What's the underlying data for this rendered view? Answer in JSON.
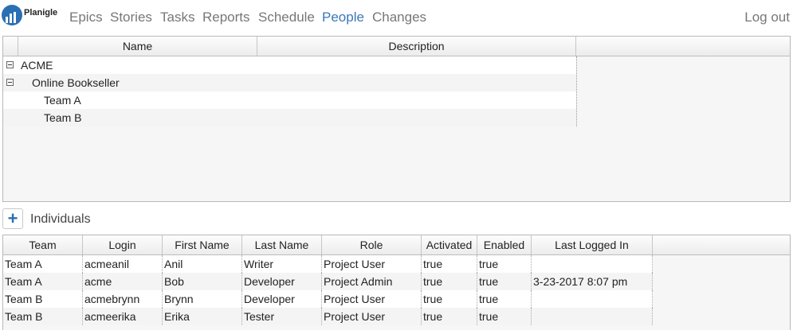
{
  "nav": {
    "logo_text": "Planigle",
    "links": [
      "Epics",
      "Stories",
      "Tasks",
      "Reports",
      "Schedule",
      "People",
      "Changes"
    ],
    "active": "People",
    "logout": "Log out"
  },
  "org_tree": {
    "columns": [
      "Name",
      "Description"
    ],
    "rows": [
      {
        "name": "ACME",
        "description": "",
        "level": 0,
        "expanded": true
      },
      {
        "name": "Online Bookseller",
        "description": "",
        "level": 1,
        "expanded": true
      },
      {
        "name": "Team A",
        "description": "",
        "level": 2
      },
      {
        "name": "Team B",
        "description": "",
        "level": 2
      }
    ]
  },
  "individuals": {
    "title": "Individuals",
    "add_icon": "plus-icon",
    "columns": [
      "Team",
      "Login",
      "First Name",
      "Last Name",
      "Role",
      "Activated",
      "Enabled",
      "Last Logged In"
    ],
    "rows": [
      [
        "Team A",
        "acmeanil",
        "Anil",
        "Writer",
        "Project User",
        "true",
        "true",
        ""
      ],
      [
        "Team A",
        "acme",
        "Bob",
        "Developer",
        "Project Admin",
        "true",
        "true",
        "3-23-2017 8:07 pm"
      ],
      [
        "Team B",
        "acmebrynn",
        "Brynn",
        "Developer",
        "Project User",
        "true",
        "true",
        ""
      ],
      [
        "Team B",
        "acmeerika",
        "Erika",
        "Tester",
        "Project User",
        "true",
        "true",
        ""
      ]
    ]
  },
  "colors": {
    "accent": "#3a78b8",
    "brand": "#2a6fb3",
    "nav_text": "#777777"
  }
}
